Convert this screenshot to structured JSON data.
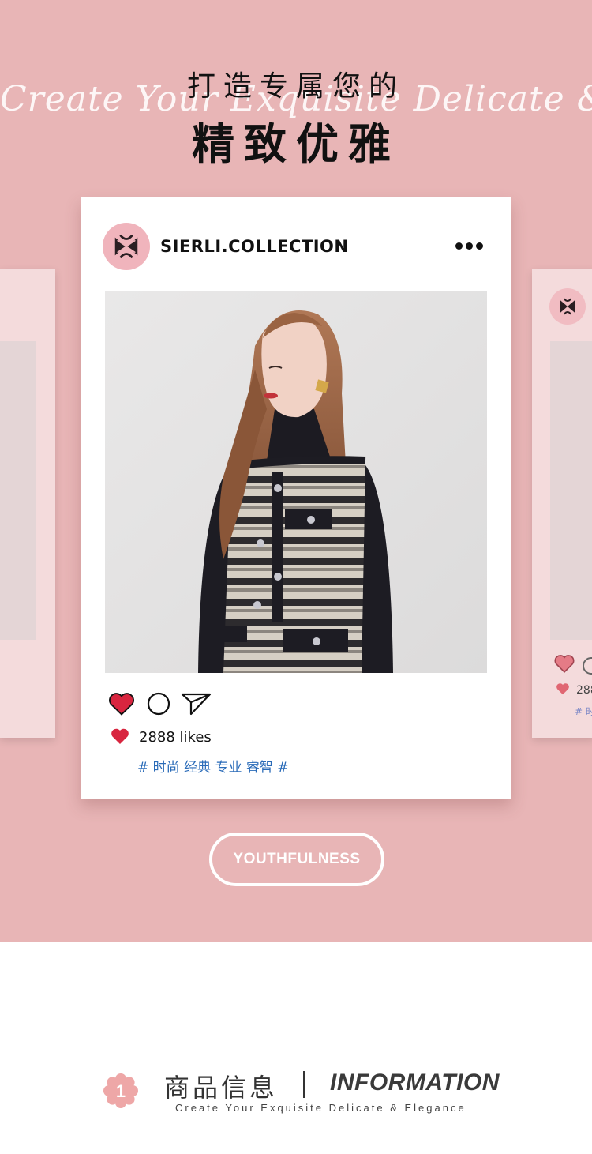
{
  "hero": {
    "script_line": "Create Your Exquisite Delicate & Elegance",
    "title_line1": "打造专属您的",
    "title_line2": "精致优雅"
  },
  "post": {
    "username": "SIERLI.COLLECTION",
    "likes": "2888 likes",
    "tags": "# 时尚 经典 专业 睿智 #"
  },
  "side_post": {
    "likes_partial": "288",
    "tag_partial": "# 时"
  },
  "pill": {
    "label": "YOUTHFULNESS"
  },
  "info": {
    "badge_number": "1",
    "title_cn": "商品信息",
    "title_en": "INFORMATION",
    "subtitle": "Create Your Exquisite Delicate & Elegance"
  },
  "colors": {
    "hero_bg": "#e8b5b6",
    "heart": "#d8253f",
    "tag_blue": "#2a6bb8",
    "side_card": "#f4dbdc"
  },
  "icons": [
    "heart-icon",
    "comment-icon",
    "send-icon",
    "more-icon",
    "brand-logo",
    "flower-badge"
  ]
}
